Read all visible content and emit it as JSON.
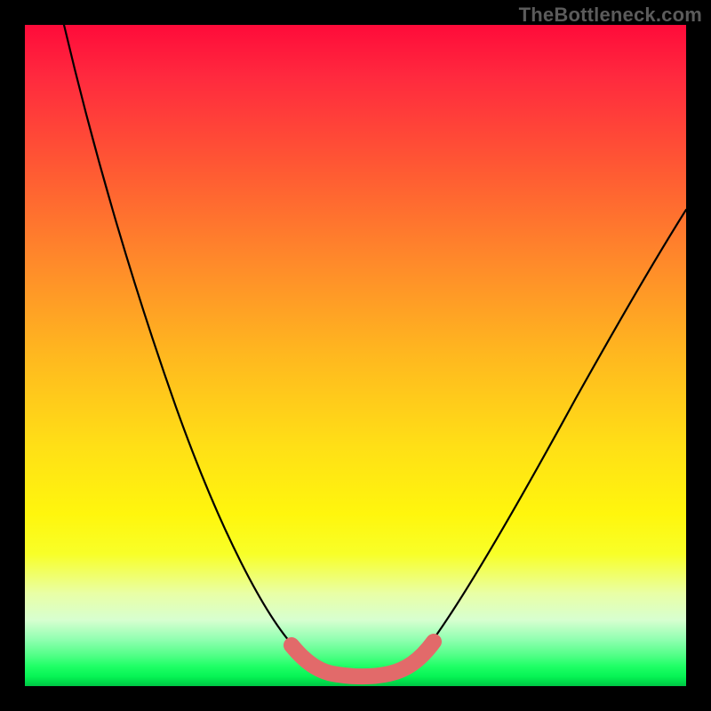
{
  "watermark": "TheBottleneck.com",
  "chart_data": {
    "type": "line",
    "title": "",
    "xlabel": "",
    "ylabel": "",
    "xlim": [
      0,
      100
    ],
    "ylim": [
      0,
      100
    ],
    "series": [
      {
        "name": "bottleneck-curve",
        "x": [
          6,
          10,
          14,
          18,
          22,
          26,
          30,
          34,
          38,
          40,
          43,
          46,
          49,
          52,
          55,
          58,
          61,
          66,
          72,
          78,
          84,
          90,
          96,
          100
        ],
        "y": [
          100,
          89,
          78,
          67,
          57,
          47,
          38,
          29,
          19,
          12,
          8,
          5,
          4,
          4,
          5,
          8,
          13,
          22,
          33,
          43,
          52,
          60,
          67,
          72
        ]
      },
      {
        "name": "optimal-band",
        "x": [
          40,
          43,
          46,
          49,
          52,
          55,
          58
        ],
        "y": [
          8,
          5,
          4,
          4,
          4,
          5,
          8
        ]
      }
    ],
    "gradient_stops": [
      {
        "pos": 0,
        "color": "#ff0b3a"
      },
      {
        "pos": 0.5,
        "color": "#ffe016"
      },
      {
        "pos": 0.8,
        "color": "#f8ff28"
      },
      {
        "pos": 0.97,
        "color": "#1fff66"
      },
      {
        "pos": 1.0,
        "color": "#00c545"
      }
    ]
  }
}
